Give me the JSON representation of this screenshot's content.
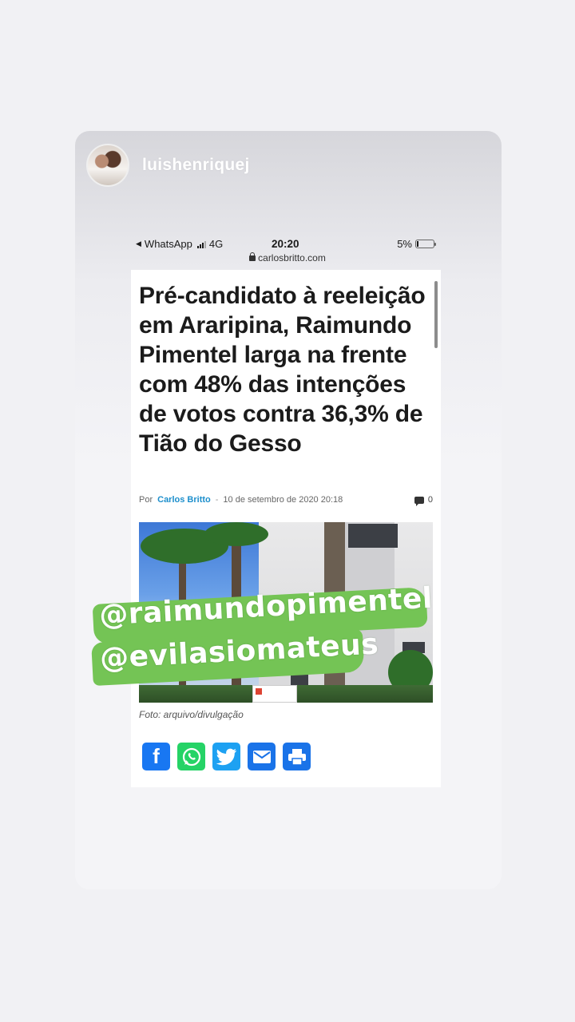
{
  "story": {
    "username": "luishenriquej"
  },
  "phone_status": {
    "back_app": "WhatsApp",
    "network": "4G",
    "time": "20:20",
    "battery": "5%",
    "url": "carlosbritto.com"
  },
  "article": {
    "headline": "Pré-candidato à reeleição em Araripina, Raimundo Pimentel larga na frente com 48% das intenções de votos contra 36,3% de Tião do Gesso",
    "by_prefix": "Por",
    "author": "Carlos Britto",
    "separator": "-",
    "date": "10 de setembro de 2020 20:18",
    "comments_count": "0",
    "photo_caption": "Foto: arquivo/divulgação"
  },
  "sticker": {
    "line1": "@raimundopimentel",
    "line2": "@evilasiomateus"
  },
  "share_buttons": [
    {
      "icon": "facebook-icon",
      "color": "#1877f2"
    },
    {
      "icon": "whatsapp-icon",
      "color": "#25d366"
    },
    {
      "icon": "twitter-icon",
      "color": "#1da1f2"
    },
    {
      "icon": "email-icon",
      "color": "#1a73e8"
    },
    {
      "icon": "print-icon",
      "color": "#1a73e8"
    }
  ]
}
